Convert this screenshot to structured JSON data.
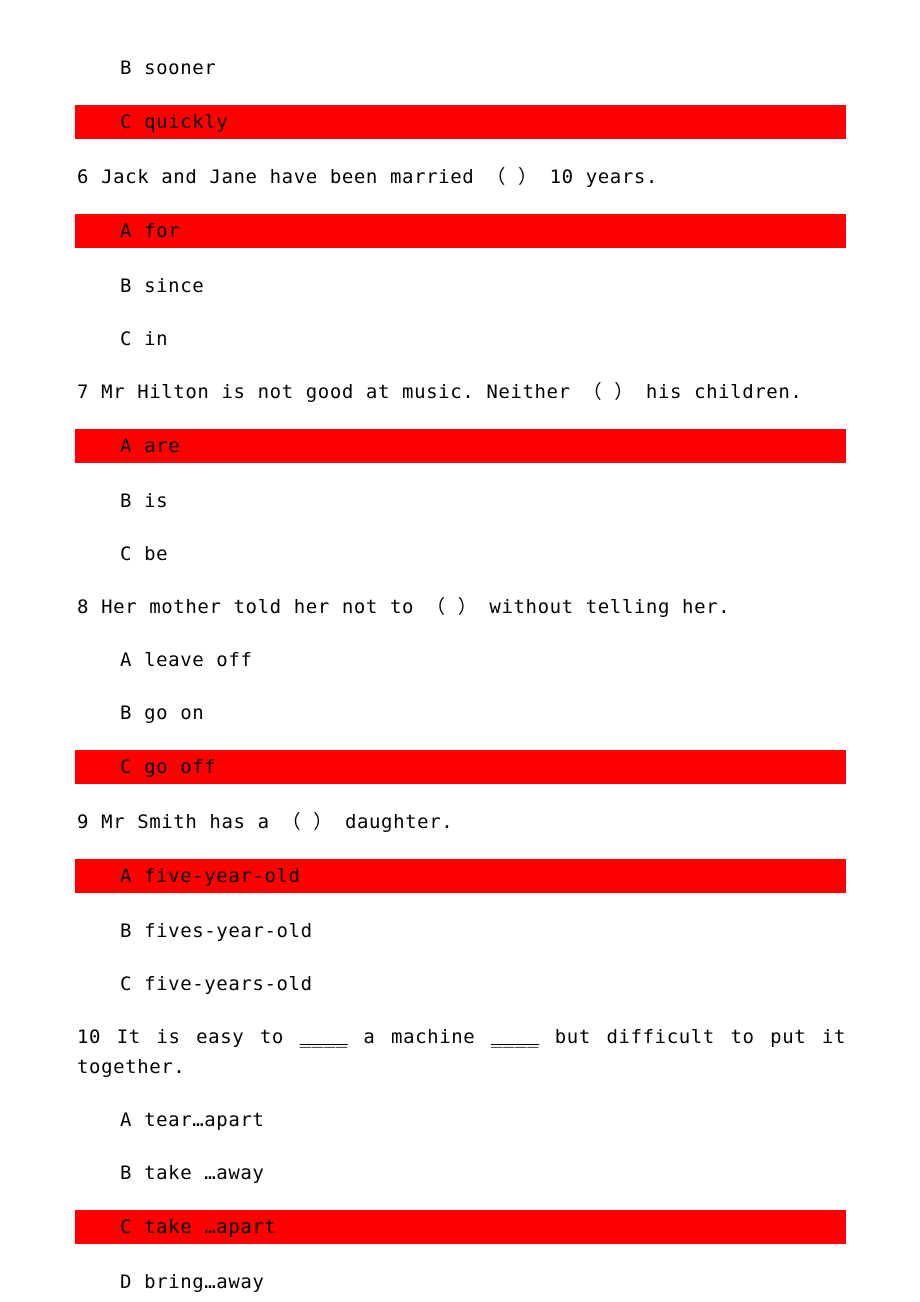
{
  "document": {
    "type": "english-multiple-choice-worksheet",
    "answer_highlight_color": "#ff0000",
    "text_color": "#000000",
    "background_color": "#ffffff",
    "blocks": [
      {
        "kind": "option",
        "label": "B",
        "text": "B sooner",
        "highlighted": false
      },
      {
        "kind": "option",
        "label": "C",
        "text": "C quickly",
        "highlighted": true
      },
      {
        "kind": "question",
        "number": "6",
        "text": "6 Jack and Jane have been married （ ） 10 years."
      },
      {
        "kind": "option",
        "label": "A",
        "text": "A for",
        "highlighted": true
      },
      {
        "kind": "option",
        "label": "B",
        "text": "B since",
        "highlighted": false
      },
      {
        "kind": "option",
        "label": "C",
        "text": "C in",
        "highlighted": false
      },
      {
        "kind": "question",
        "number": "7",
        "text": "7 Mr Hilton is not good at music. Neither （ ） his children."
      },
      {
        "kind": "option",
        "label": "A",
        "text": "A are",
        "highlighted": true
      },
      {
        "kind": "option",
        "label": "B",
        "text": "B is",
        "highlighted": false
      },
      {
        "kind": "option",
        "label": "C",
        "text": "C be",
        "highlighted": false
      },
      {
        "kind": "question",
        "number": "8",
        "text": "8 Her mother told her not to （ ） without telling her."
      },
      {
        "kind": "option",
        "label": "A",
        "text": "A leave off",
        "highlighted": false
      },
      {
        "kind": "option",
        "label": "B",
        "text": "B go on",
        "highlighted": false
      },
      {
        "kind": "option",
        "label": "C",
        "text": "C go off",
        "highlighted": true
      },
      {
        "kind": "question",
        "number": "9",
        "text": "9 Mr Smith has a （ ） daughter."
      },
      {
        "kind": "option",
        "label": "A",
        "text": "A five-year-old",
        "highlighted": true
      },
      {
        "kind": "option",
        "label": "B",
        "text": "B fives-year-old",
        "highlighted": false
      },
      {
        "kind": "option",
        "label": "C",
        "text": "C five-years-old",
        "highlighted": false
      },
      {
        "kind": "question-justified",
        "number": "10",
        "text": "10 It is easy to ____ a machine ____ but difficult to put it together.",
        "parts": [
          "10 It is easy to ",
          "____",
          " a machine ",
          "____",
          " but difficult to put it together."
        ]
      },
      {
        "kind": "option",
        "label": "A",
        "text": "A tear…apart",
        "highlighted": false
      },
      {
        "kind": "option",
        "label": "B",
        "text": "B take …away",
        "highlighted": false
      },
      {
        "kind": "option",
        "label": "C",
        "text": "C take …apart",
        "highlighted": true
      },
      {
        "kind": "option",
        "label": "D",
        "text": "D bring…away",
        "highlighted": false
      }
    ]
  }
}
